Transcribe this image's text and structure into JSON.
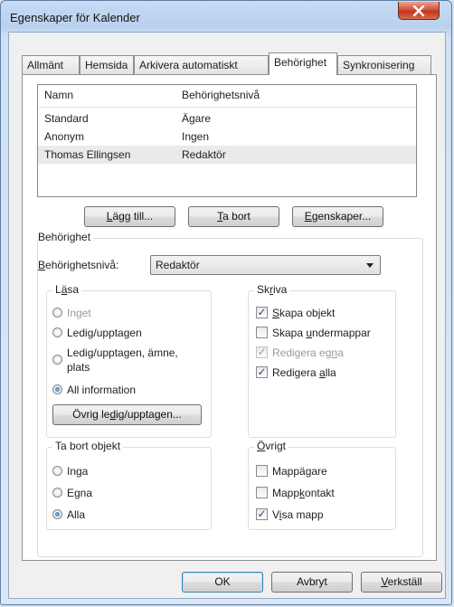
{
  "window": {
    "title": "Egenskaper för Kalender"
  },
  "tabs": [
    {
      "label": "Allmänt"
    },
    {
      "label": "Hemsida"
    },
    {
      "label": "Arkivera automatiskt"
    },
    {
      "label": "Behörighet"
    },
    {
      "label": "Synkronisering"
    }
  ],
  "permissions_list": {
    "headers": {
      "name": "Namn",
      "level": "Behörighetsnivå"
    },
    "rows": [
      {
        "name": "Standard",
        "level": "Ägare"
      },
      {
        "name": "Anonym",
        "level": "Ingen"
      },
      {
        "name": "Thomas Ellingsen",
        "level": "Redaktör"
      }
    ]
  },
  "list_buttons": {
    "add": "Lägg till...",
    "remove": "Ta bort",
    "properties": "Egenskaper..."
  },
  "permission": {
    "group_title": "Behörighet",
    "level_label": "Behörighetsnivå:",
    "level_value": "Redaktör"
  },
  "read": {
    "title": "Läsa",
    "options": [
      "Inget",
      "Ledig/upptagen",
      "Ledig/upptagen, ämne,",
      "plats",
      "All information"
    ],
    "button": "Övrig ledig/upptagen..."
  },
  "write": {
    "title": "Skriva",
    "options": [
      "Skapa objekt",
      "Skapa undermappar",
      "Redigera egna",
      "Redigera alla"
    ]
  },
  "delete": {
    "title": "Ta bort objekt",
    "options": [
      "Inga",
      "Egna",
      "Alla"
    ]
  },
  "other": {
    "title": "Övrigt",
    "options": [
      "Mappägare",
      "Mappkontakt",
      "Visa mapp"
    ]
  },
  "footer": {
    "ok": "OK",
    "cancel": "Avbryt",
    "apply": "Verkställ"
  }
}
